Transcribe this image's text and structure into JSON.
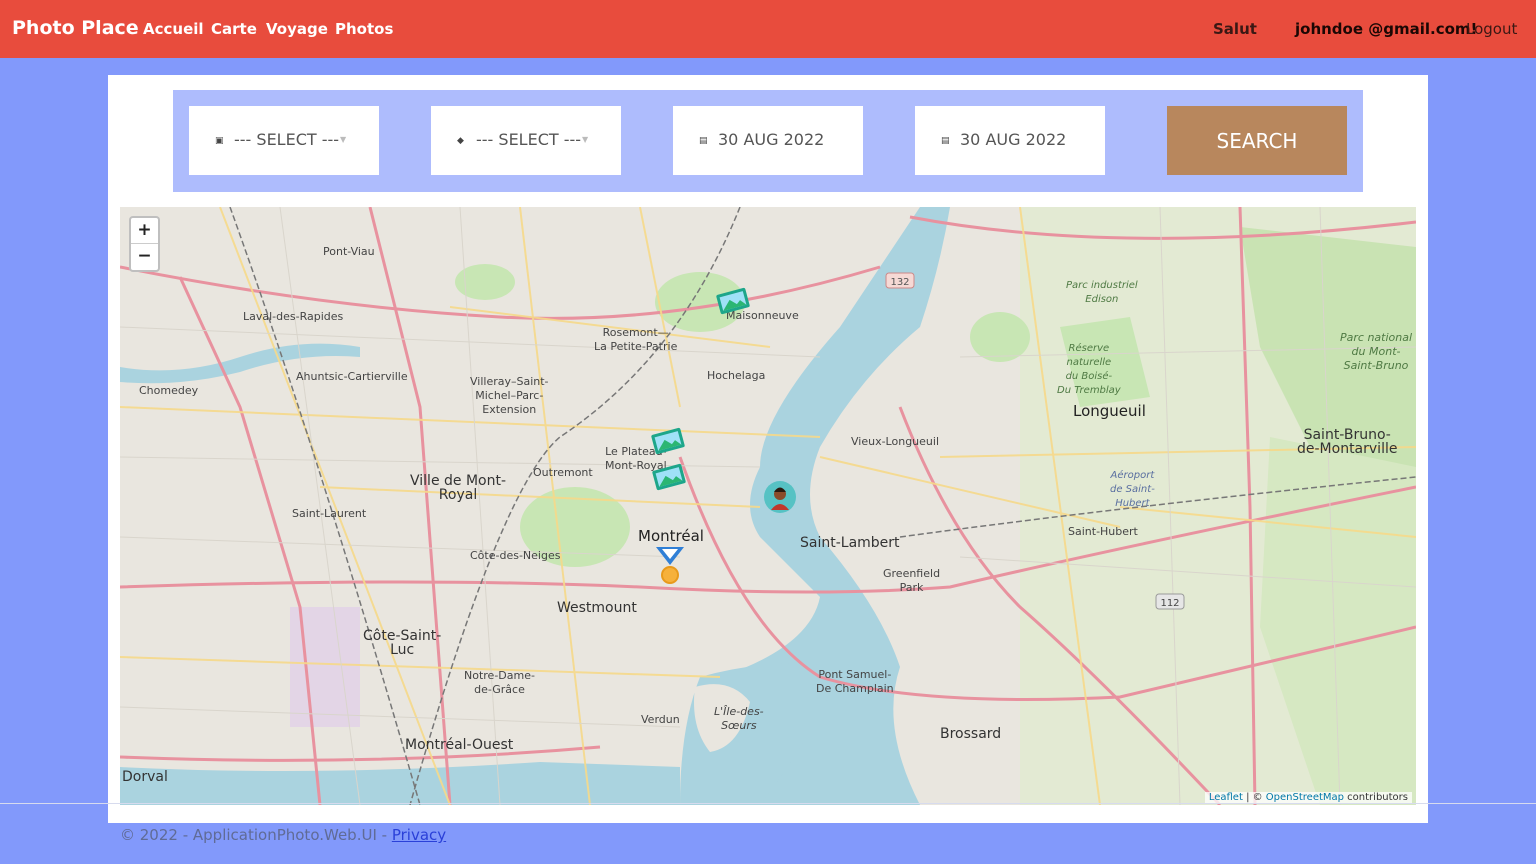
{
  "nav": {
    "brand": "Photo Place",
    "links": [
      "Accueil",
      "Carte",
      "Voyage",
      "Photos"
    ],
    "greeting": "Salut",
    "email": "johndoe @gmail.com!",
    "logout": "Logout"
  },
  "filters": {
    "select1": "--- SELECT ---",
    "select2": "--- SELECT ---",
    "date_from": "30 AUG 2022",
    "date_to": "30 AUG 2022",
    "search": "SEARCH"
  },
  "map": {
    "zoom_in": "+",
    "zoom_out": "−",
    "labels": [
      "Pont-Viau",
      "Laval-des-Rapides",
      "Chomedey",
      "Ahuntsic-Cartierville",
      "Villeray–Saint-\nMichel–Parc-\nExtension",
      "Rosemont—\nLa Petite-Patrie",
      "Maisonneuve",
      "Hochelaga",
      "Le Plateau-\nMont-Royal",
      "Outremont",
      "Ville de Mont-\nRoyal",
      "Saint-Laurent",
      "Côte-des-Neiges",
      "Montréal",
      "Westmount",
      "Côte-Saint-\nLuc",
      "Notre-Dame-\nde-Grâce",
      "Verdun",
      "L'Île-des-\nSœurs",
      "Montréal-Ouest",
      "Dorval",
      "Vieux-Longueuil",
      "Longueuil",
      "Saint-Lambert",
      "Greenfield\nPark",
      "Saint-Hubert",
      "Saint-Bruno-\nde-Montarville",
      "Pont Samuel-\nDe Champlain",
      "Brossard",
      "Parc industriel\nEdison",
      "Réserve\nnaturelle\ndu Boisé-\nDu Tremblay",
      "Parc national\ndu Mont-\nSaint-Bruno",
      "Aéroport\nde Saint-\nHubert"
    ],
    "route_shields": [
      "132",
      "112"
    ],
    "markers": [
      "photo-marker",
      "photo-marker",
      "photo-marker",
      "person-marker",
      "location-pin"
    ],
    "attribution_leaflet": "Leaflet",
    "attribution_sep": " | © ",
    "attribution_osm": "OpenStreetMap",
    "attribution_tail": " contributors"
  },
  "footer": {
    "text": "© 2022 - ApplicationPhoto.Web.UI - ",
    "privacy": "Privacy"
  },
  "colors": {
    "navbar": "#e84c3d",
    "background": "#8299fb",
    "filter_bar": "#aebcfd",
    "search_button": "#b8875d",
    "water": "#aad3df",
    "park": "#c8e6b4"
  }
}
